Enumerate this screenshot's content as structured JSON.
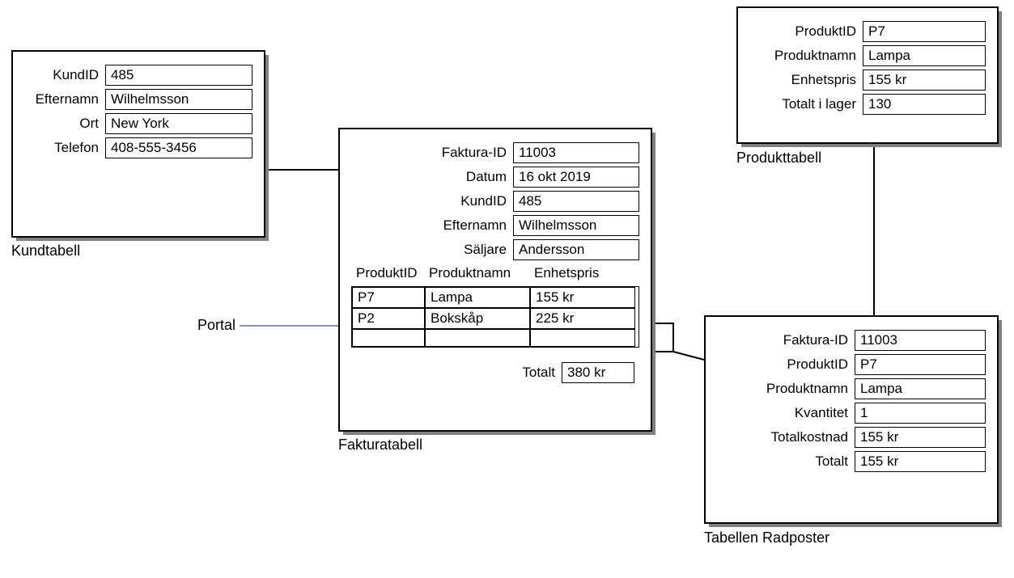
{
  "kund": {
    "caption": "Kundtabell",
    "fields": {
      "kundid_label": "KundID",
      "kundid_value": "485",
      "efternamn_label": "Efternamn",
      "efternamn_value": "Wilhelmsson",
      "ort_label": "Ort",
      "ort_value": "New York",
      "telefon_label": "Telefon",
      "telefon_value": "408-555-3456"
    }
  },
  "faktura": {
    "caption": "Fakturatabell",
    "fields": {
      "fakturaid_label": "Faktura-ID",
      "fakturaid_value": "11003",
      "datum_label": "Datum",
      "datum_value": "16 okt 2019",
      "kundid_label": "KundID",
      "kundid_value": "485",
      "efternamn_label": "Efternamn",
      "efternamn_value": "Wilhelmsson",
      "saljare_label": "Säljare",
      "saljare_value": "Andersson"
    },
    "portal_headers": {
      "produktid": "ProduktID",
      "produktnamn": "Produktnamn",
      "enhetspris": "Enhetspris"
    },
    "portal_rows": [
      {
        "produktid": "P7",
        "produktnamn": "Lampa",
        "enhetspris": "155 kr"
      },
      {
        "produktid": "P2",
        "produktnamn": "Bokskåp",
        "enhetspris": "225 kr"
      },
      {
        "produktid": "",
        "produktnamn": "",
        "enhetspris": ""
      }
    ],
    "totalt_label": "Totalt",
    "totalt_value": "380 kr"
  },
  "produkt": {
    "caption": "Produkttabell",
    "fields": {
      "produktid_label": "ProduktID",
      "produktid_value": "P7",
      "produktnamn_label": "Produktnamn",
      "produktnamn_value": "Lampa",
      "enhetspris_label": "Enhetspris",
      "enhetspris_value": "155 kr",
      "lager_label": "Totalt i lager",
      "lager_value": "130"
    }
  },
  "radposter": {
    "caption": "Tabellen Radposter",
    "fields": {
      "fakturaid_label": "Faktura-ID",
      "fakturaid_value": "11003",
      "produktid_label": "ProduktID",
      "produktid_value": "P7",
      "produktnamn_label": "Produktnamn",
      "produktnamn_value": "Lampa",
      "kvantitet_label": "Kvantitet",
      "kvantitet_value": "1",
      "totalkostnad_label": "Totalkostnad",
      "totalkostnad_value": "155 kr",
      "totalt_label": "Totalt",
      "totalt_value": "155 kr"
    }
  },
  "annotation": {
    "portal": "Portal"
  }
}
